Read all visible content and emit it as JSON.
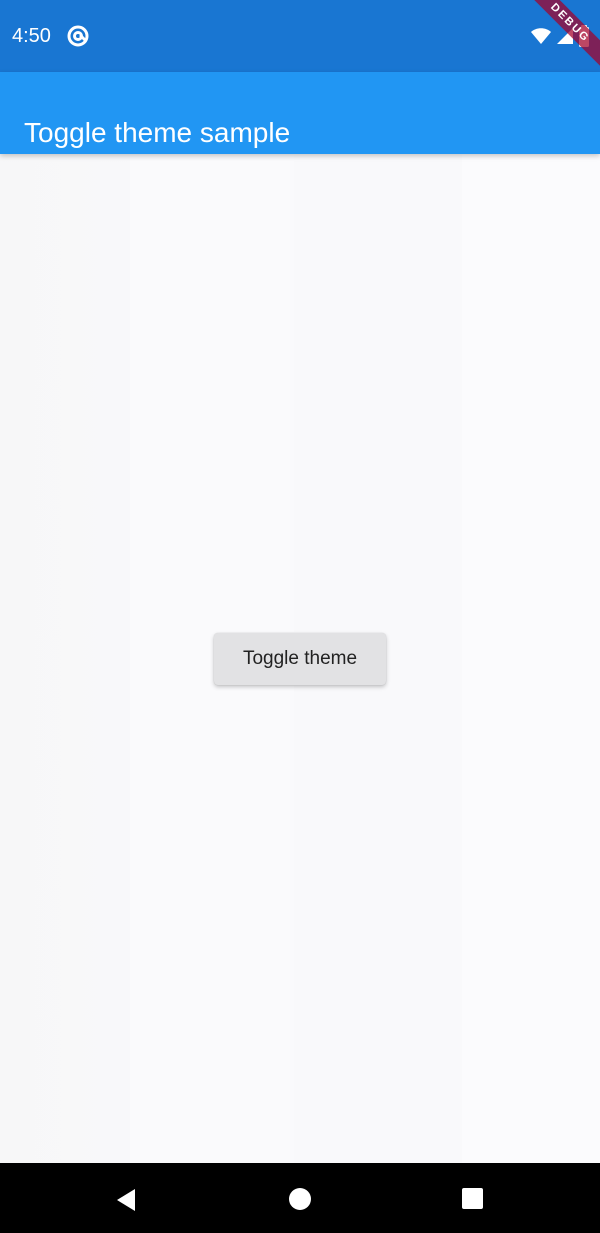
{
  "status_bar": {
    "time": "4:50",
    "app_icon": "at-sign-icon",
    "right_icons": [
      "wifi-icon",
      "signal-icon",
      "battery-icon"
    ],
    "colors": {
      "background": "#1976d2",
      "foreground": "#ffffff"
    }
  },
  "app_bar": {
    "title": "Toggle theme sample",
    "background": "#2196f3",
    "text_color": "#ffffff"
  },
  "main": {
    "toggle_label": "Toggle theme",
    "background": "#f9f8fc",
    "button_background": "#e2e2e4",
    "button_text": "#222222"
  },
  "navigation": {
    "items": [
      "back-icon",
      "home-icon",
      "recents-icon"
    ],
    "background": "#000000",
    "foreground": "#ffffff"
  },
  "debug_banner": {
    "label": "DEBUG",
    "color": "#a30028"
  }
}
